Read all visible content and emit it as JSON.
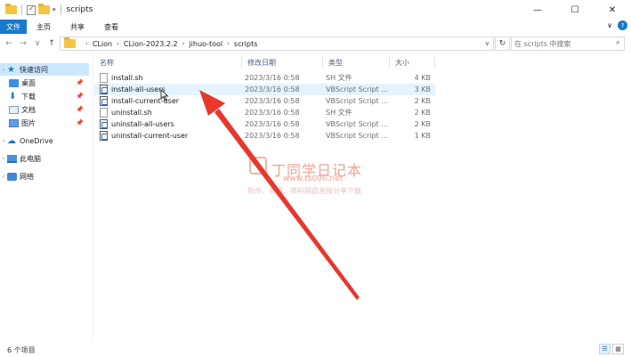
{
  "window": {
    "title": "scripts",
    "minimize_glyph": "—",
    "maximize_glyph": "☐",
    "close_glyph": "✕"
  },
  "ribbon": {
    "tabs": [
      "文件",
      "主页",
      "共享",
      "查看"
    ],
    "expand_glyph": "∨",
    "help_glyph": "?"
  },
  "nav": {
    "back_glyph": "←",
    "forward_glyph": "→",
    "recent_glyph": "∨",
    "up_glyph": "↑",
    "breadcrumbs": [
      "CLion",
      "CLion-2023.2.2",
      "jihuo-tool",
      "scripts"
    ],
    "refresh_glyph": "↻",
    "search_placeholder": "在 scripts 中搜索"
  },
  "sidebar": {
    "items": [
      {
        "label": "快速访问",
        "icon": "star-icon"
      },
      {
        "label": "桌面",
        "icon": "desktop-icon",
        "pinned": true
      },
      {
        "label": "下载",
        "icon": "download-icon",
        "pinned": true
      },
      {
        "label": "文档",
        "icon": "document-icon",
        "pinned": true
      },
      {
        "label": "图片",
        "icon": "picture-icon",
        "pinned": true
      },
      {
        "label": "OneDrive",
        "icon": "cloud-icon"
      },
      {
        "label": "此电脑",
        "icon": "computer-icon"
      },
      {
        "label": "网络",
        "icon": "network-icon"
      }
    ]
  },
  "columns": {
    "name": "名称",
    "date": "修改日期",
    "type": "类型",
    "size": "大小"
  },
  "files": [
    {
      "name": "install.sh",
      "date": "2023/3/16 0:58",
      "type": "SH 文件",
      "size": "4 KB",
      "icon": "sh-file-icon"
    },
    {
      "name": "install-all-users",
      "date": "2023/3/16 0:58",
      "type": "VBScript Script ...",
      "size": "3 KB",
      "icon": "vbscript-file-icon"
    },
    {
      "name": "install-current-user",
      "date": "2023/3/16 0:58",
      "type": "VBScript Script ...",
      "size": "2 KB",
      "icon": "vbscript-file-icon"
    },
    {
      "name": "uninstall.sh",
      "date": "2023/3/16 0:58",
      "type": "SH 文件",
      "size": "2 KB",
      "icon": "sh-file-icon"
    },
    {
      "name": "uninstall-all-users",
      "date": "2023/3/16 0:58",
      "type": "VBScript Script ...",
      "size": "2 KB",
      "icon": "vbscript-file-icon"
    },
    {
      "name": "uninstall-current-user",
      "date": "2023/3/16 0:58",
      "type": "VBScript Script ...",
      "size": "1 KB",
      "icon": "vbscript-file-icon"
    }
  ],
  "watermark": {
    "title": "丁同学日记本",
    "url": "www.ts006.net",
    "subtitle": "软件、资源、资料网盘直接分享下载"
  },
  "status": {
    "item_count": "6 个项目"
  },
  "colors": {
    "accent": "#1979ca",
    "hover_row": "#e5f3ff",
    "selected_nav": "#cce8ff",
    "annotation_arrow": "#e8372c"
  }
}
